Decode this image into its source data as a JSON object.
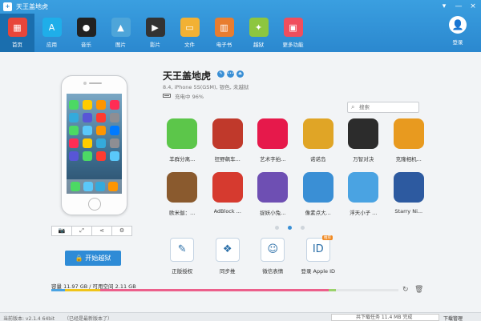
{
  "titlebar": {
    "title": "天王盖地虎",
    "buttons": [
      "▾",
      "—",
      "×"
    ]
  },
  "nav": [
    {
      "label": "首页",
      "icon": "store-icon",
      "glyph": "▦",
      "color": "#e8463a",
      "active": true
    },
    {
      "label": "应用",
      "icon": "app-store-icon",
      "glyph": "A",
      "color": "#1faee9"
    },
    {
      "label": "音乐",
      "icon": "music-disc-icon",
      "glyph": "●",
      "color": "#222222"
    },
    {
      "label": "图片",
      "icon": "picture-icon",
      "glyph": "▲",
      "color": "#4ea5d9"
    },
    {
      "label": "影片",
      "icon": "clapperboard-icon",
      "glyph": "▶",
      "color": "#333333"
    },
    {
      "label": "文件",
      "icon": "folder-icon",
      "glyph": "▭",
      "color": "#f2b134"
    },
    {
      "label": "电子书",
      "icon": "book-icon",
      "glyph": "▥",
      "color": "#e87d2f"
    },
    {
      "label": "越狱",
      "icon": "pineapple-icon",
      "glyph": "✦",
      "color": "#8dc63f"
    },
    {
      "label": "更多功能",
      "icon": "more-functions-icon",
      "glyph": "▣",
      "color": "#f04e5d"
    }
  ],
  "login": {
    "label": "登录",
    "glyph": "👤"
  },
  "device": {
    "name": "天王盖地虎",
    "info": "8.4, iPhone 5S(GSM), 银色, 未越狱",
    "battery": "充电中 96%"
  },
  "device_tools": [
    "📷",
    "⤢",
    "⋖",
    "⚙"
  ],
  "jailbreak": {
    "label": "开始越狱",
    "glyph": "🔒"
  },
  "search": {
    "placeholder": "搜索",
    "glyph": "⌕"
  },
  "apps": [
    {
      "label": "羊群分离...",
      "color": "#5cc64a"
    },
    {
      "label": "狂野飙车...",
      "color": "#c0392b"
    },
    {
      "label": "艺术字拍...",
      "color": "#e6194b"
    },
    {
      "label": "诺诺岛",
      "color": "#e0a526"
    },
    {
      "label": "万智对决",
      "color": "#2c2c2c"
    },
    {
      "label": "克隆相机...",
      "color": "#e89a1f"
    },
    {
      "label": "欧米伽：...",
      "color": "#8a5a2e"
    },
    {
      "label": "AdBlock ...",
      "color": "#d63a2f"
    },
    {
      "label": "捉妖小兔...",
      "color": "#6e4fb3"
    },
    {
      "label": "像素点大...",
      "color": "#3a8fd5"
    },
    {
      "label": "浮天小子 ...",
      "color": "#4aa3e2"
    },
    {
      "label": "Starry Ni...",
      "color": "#2d5aa0"
    }
  ],
  "pager": {
    "count": 3,
    "active": 1
  },
  "quick_actions": [
    {
      "label": "正版授权",
      "glyph": "✎",
      "icon": "wrench-icon"
    },
    {
      "label": "同步推",
      "glyph": "❖",
      "icon": "tongbu-icon"
    },
    {
      "label": "微信表情",
      "glyph": "☺",
      "icon": "smiley-icon"
    },
    {
      "label": "登录 Apple ID",
      "glyph": "ID",
      "icon": "apple-id-icon",
      "badge": "推荐"
    }
  ],
  "storage": {
    "text": "容量 11.97 GB / 可用空间  2.11 GB",
    "segments": [
      {
        "color": "#4aa3e2",
        "fraction": 0.04
      },
      {
        "color": "#f0c419",
        "fraction": 0.1
      },
      {
        "color": "#ec5f8b",
        "fraction": 0.66
      },
      {
        "color": "#9bd26c",
        "fraction": 0.02
      }
    ]
  },
  "status": {
    "version": "当前版本: v2.1.4 64bit",
    "update": "（已经是最新版本了）",
    "download": "共下载任务   11.4 MB 完成",
    "manager": "下载管理"
  }
}
